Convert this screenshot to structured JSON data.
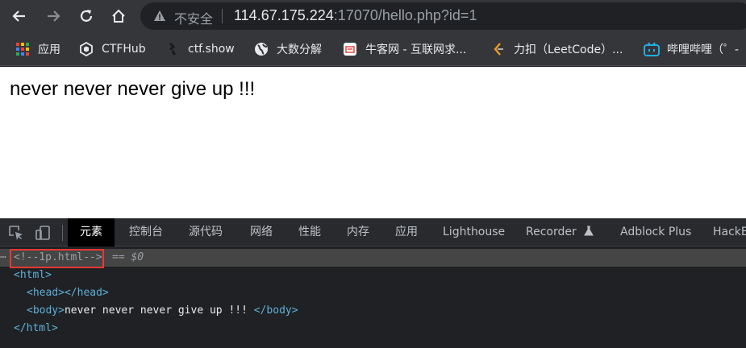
{
  "browser": {
    "address": {
      "security_label": "不安全",
      "host": "114.67.175.224",
      "rest": ":17070/hello.php?id=1"
    },
    "bookmarks": [
      {
        "icon": "apps-grid-icon",
        "label": "应用"
      },
      {
        "icon": "ctfhub-logo-icon",
        "label": "CTFHub"
      },
      {
        "icon": "ctfshow-logo-icon",
        "label": "ctf.show"
      },
      {
        "icon": "globe-icon",
        "label": "大数分解"
      },
      {
        "icon": "nowcoder-logo-icon",
        "label": "牛客网 - 互联网求..."
      },
      {
        "icon": "leetcode-logo-icon",
        "label": "力扣（LeetCode）..."
      },
      {
        "icon": "bilibili-logo-icon",
        "label": "哔哩哔哩（゜-"
      }
    ]
  },
  "page": {
    "body_text": "never never never give up !!!"
  },
  "devtools": {
    "tabs": [
      "元素",
      "控制台",
      "源代码",
      "网络",
      "性能",
      "内存",
      "应用",
      "Lighthouse",
      "Recorder",
      "Adblock Plus",
      "HackBar"
    ],
    "active_tab": "元素",
    "dom": {
      "comment": "<!--1p.html-->",
      "selected_ref": "== $0",
      "html_open": "<html>",
      "head": "<head></head>",
      "body_open": "<body>",
      "body_text": "never never never give up !!! ",
      "body_close": "</body>",
      "html_close": "</html>"
    }
  },
  "colors": {
    "highlight_box": "#e53935",
    "tag": "#5db0d7",
    "comment": "#9aa0a6"
  }
}
